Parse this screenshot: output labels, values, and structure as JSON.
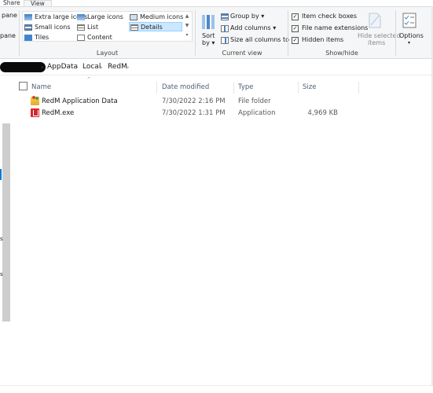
{
  "tabs": {
    "share": "Share",
    "view": "View"
  },
  "left_pane": {
    "item1": "pane",
    "item2": "pane"
  },
  "layout": {
    "items": [
      "Extra large icons",
      "Large icons",
      "Medium icons",
      "Small icons",
      "List",
      "Details",
      "Tiles",
      "Content"
    ],
    "selected": "Details",
    "group_label": "Layout"
  },
  "current_view": {
    "sort_label": "Sort",
    "sort_by": "by",
    "group_by": "Group by",
    "add_columns": "Add columns",
    "size_columns": "Size all columns to fit",
    "group_label": "Current view"
  },
  "show_hide": {
    "item_check_boxes": "Item check boxes",
    "file_name_extensions": "File name extensions",
    "hidden_items": "Hidden items",
    "hide_selected_1": "Hide selected",
    "hide_selected_2": "items",
    "group_label": "Show/hide"
  },
  "options": {
    "label": "Options"
  },
  "address": {
    "crumbs": [
      "AppData",
      "Local",
      "RedM"
    ]
  },
  "nav_marks": [
    "s",
    "s"
  ],
  "columns": {
    "name": "Name",
    "date": "Date modified",
    "type": "Type",
    "size": "Size"
  },
  "files": [
    {
      "name": "RedM Application Data",
      "date": "7/30/2022 2:16 PM",
      "type": "File folder",
      "size": "",
      "icon": "folder-icon"
    },
    {
      "name": "RedM.exe",
      "date": "7/30/2022 1:31 PM",
      "type": "Application",
      "size": "4,969 KB",
      "icon": "application-icon"
    }
  ]
}
